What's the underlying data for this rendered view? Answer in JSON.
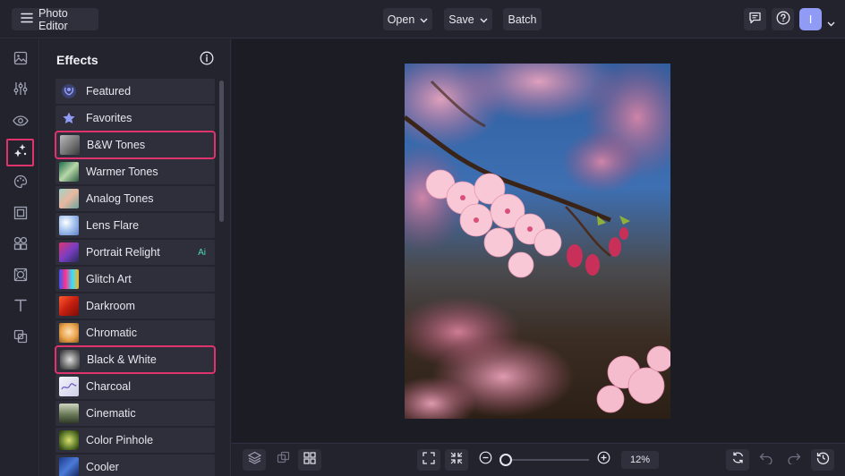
{
  "topbar": {
    "app_title": "Photo Editor",
    "open_label": "Open",
    "save_label": "Save",
    "batch_label": "Batch",
    "avatar_initial": "I"
  },
  "rail": {
    "items": [
      "image-icon",
      "sliders-icon",
      "eye-icon",
      "effects-sparkle-icon",
      "palette-icon",
      "frame-icon",
      "shapes-icon",
      "texture-icon",
      "text-icon",
      "overlay-icon"
    ],
    "active": "effects-sparkle-icon"
  },
  "panel": {
    "title": "Effects",
    "items": [
      {
        "label": "Featured",
        "thumb": "laurel-icon"
      },
      {
        "label": "Favorites",
        "thumb": "star-icon"
      },
      {
        "label": "B&W Tones",
        "thumb": "bw-photo",
        "highlighted": true
      },
      {
        "label": "Warmer Tones",
        "thumb": "leaf-photo"
      },
      {
        "label": "Analog Tones",
        "thumb": "analog-photo"
      },
      {
        "label": "Lens Flare",
        "thumb": "flare-photo"
      },
      {
        "label": "Portrait Relight",
        "thumb": "relight-photo",
        "badge": "Ai"
      },
      {
        "label": "Glitch Art",
        "thumb": "glitch-photo"
      },
      {
        "label": "Darkroom",
        "thumb": "darkroom-photo"
      },
      {
        "label": "Chromatic",
        "thumb": "chromatic-photo"
      },
      {
        "label": "Black & White",
        "thumb": "black-white-photo",
        "highlighted": true
      },
      {
        "label": "Charcoal",
        "thumb": "charcoal-photo"
      },
      {
        "label": "Cinematic",
        "thumb": "cinematic-photo"
      },
      {
        "label": "Color Pinhole",
        "thumb": "pinhole-photo"
      },
      {
        "label": "Cooler",
        "thumb": "cooler-photo"
      }
    ]
  },
  "zoom": {
    "percent_label": "12%",
    "level": 0.12
  },
  "colors": {
    "accent_highlight": "#e0336e",
    "avatar": "#8f9bf5",
    "ai_badge": "#4fd8b6"
  }
}
